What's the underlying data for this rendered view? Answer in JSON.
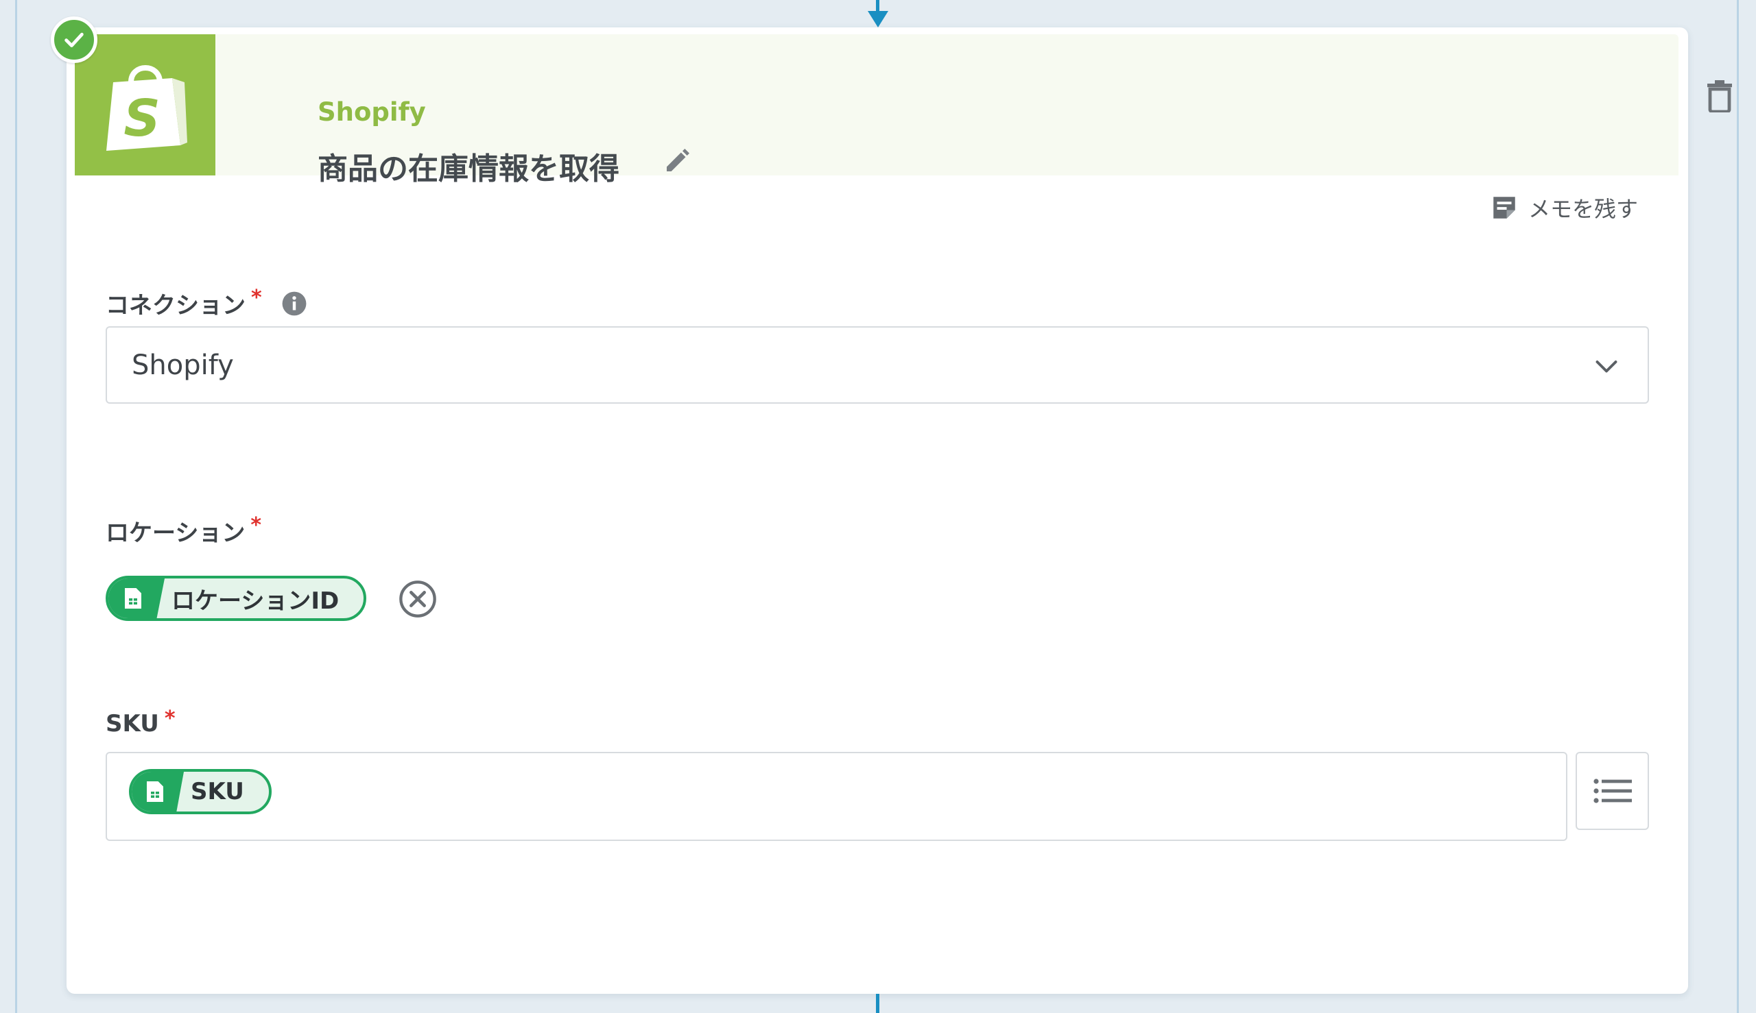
{
  "step": {
    "app_name": "Shopify",
    "title": "商品の在庫情報を取得",
    "status": "completed"
  },
  "memo": {
    "label": "メモを残す"
  },
  "fields": {
    "connection": {
      "label": "コネクション",
      "required_mark": "*",
      "value": "Shopify"
    },
    "location": {
      "label": "ロケーション",
      "required_mark": "*",
      "chip": "ロケーションID"
    },
    "sku": {
      "label": "SKU",
      "required_mark": "*",
      "chip": "SKU"
    }
  },
  "icons": {
    "status": "check-icon",
    "logo": "shopify-bag-icon",
    "edit": "pencil-icon",
    "delete": "trash-icon",
    "memo": "note-icon",
    "info": "info-icon",
    "dropdown": "chevron-down-icon",
    "chip": "spreadsheet-icon",
    "clear": "close-circle-icon",
    "list": "list-icon"
  },
  "colors": {
    "brand": "#93c047",
    "accent": "#1a8fc2",
    "chip": "#22a860",
    "required": "#e0322e"
  }
}
